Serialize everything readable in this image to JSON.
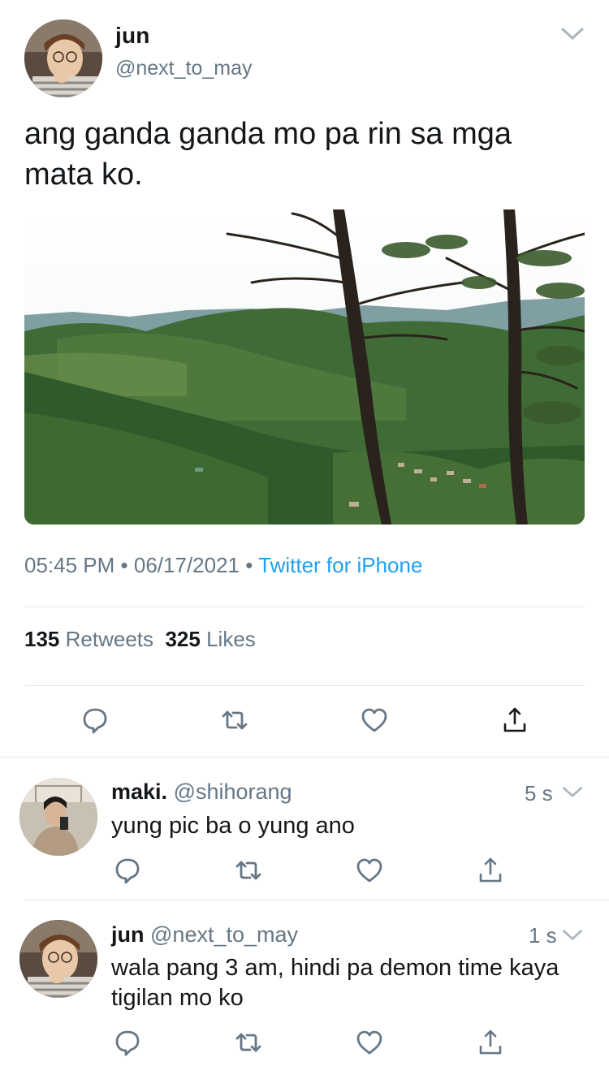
{
  "main_tweet": {
    "author_name": "jun",
    "author_handle": "@next_to_may",
    "text": "ang ganda ganda mo pa rin sa mga mata ko.",
    "time": "05:45 PM",
    "date": "06/17/2021",
    "separator": "•",
    "source": "Twitter for iPhone",
    "retweets_count": "135",
    "retweets_label": "Retweets",
    "likes_count": "325",
    "likes_label": "Likes"
  },
  "replies": [
    {
      "author_name": "maki.",
      "author_handle": "@shihorang",
      "time": "5 s",
      "text": "yung pic ba o yung ano"
    },
    {
      "author_name": "jun",
      "author_handle": "@next_to_may",
      "time": "1 s",
      "text": "wala pang 3 am, hindi pa demon time kaya tigilan mo ko"
    }
  ],
  "icons": {
    "reply": "reply-icon",
    "retweet": "retweet-icon",
    "like": "heart-icon",
    "share": "share-icon",
    "more": "chevron-down-icon"
  },
  "colors": {
    "text": "#14171a",
    "secondary": "#657786",
    "link": "#1da1f2",
    "divider": "#e1e8ed"
  }
}
